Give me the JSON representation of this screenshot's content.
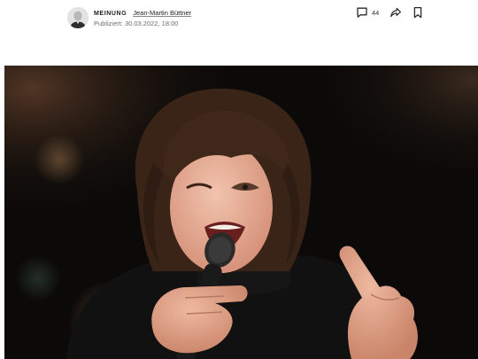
{
  "byline": {
    "kicker": "MEINUNG",
    "author": "Jean-Martin Büttner",
    "published_label": "Publiziert:",
    "published_date": "30.03.2022, 18:00"
  },
  "actions": {
    "comment_count": "44",
    "comment_icon": "comment-icon",
    "share_icon": "share-icon",
    "bookmark_icon": "bookmark-icon"
  },
  "hero_image": {
    "subject": "portrait-photo",
    "background_color": "#0c0a09"
  }
}
